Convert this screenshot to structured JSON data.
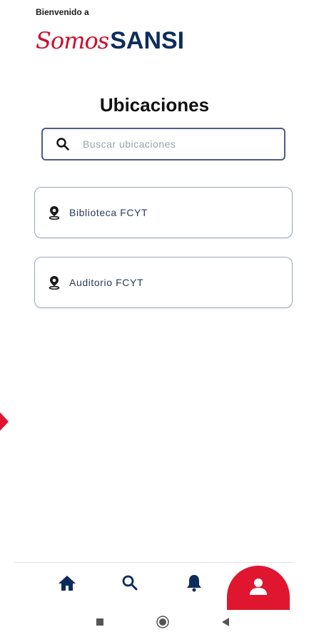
{
  "header": {
    "welcome": "Bienvenido a",
    "brand_script": "Somos",
    "brand_bold": "SANSI"
  },
  "page": {
    "title": "Ubicaciones"
  },
  "search": {
    "placeholder": "Buscar ubicaciones",
    "value": "",
    "icon": "search-icon"
  },
  "locations": [
    {
      "name": "Biblioteca FCYT",
      "icon": "location-pin-icon"
    },
    {
      "name": "Auditorio FCYT",
      "icon": "location-pin-icon"
    }
  ],
  "bottom_nav": {
    "items": [
      {
        "icon": "home-icon"
      },
      {
        "icon": "search-icon"
      },
      {
        "icon": "bell-icon"
      },
      {
        "icon": "profile-icon",
        "active": true
      }
    ]
  },
  "system_nav": {
    "items": [
      "recents-icon",
      "home-circle-icon",
      "back-triangle-icon"
    ]
  },
  "colors": {
    "brand_red": "#c8102e",
    "brand_navy": "#0d2c5c",
    "nav_icon": "#0d2c5c",
    "active_bg": "#e0152f"
  }
}
